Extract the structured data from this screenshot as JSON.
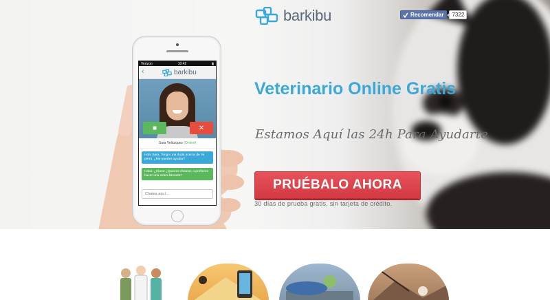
{
  "header": {
    "brand": "barkibu",
    "fb_like_label": "Recomendar",
    "fb_like_count": "7322"
  },
  "hero": {
    "headline": "Veterinario Online Gratis",
    "tagline": "Estamos Aquí las 24h Para Ayudarte",
    "cta_label": "PRUÉBALO AHORA",
    "cta_note": "30 días de prueba gratis, sin tarjeta de crédito."
  },
  "phone": {
    "carrier": "Verizon",
    "time": "10:42",
    "app_brand": "barkibu",
    "callee_name": "Sara Velázquez",
    "callee_status": "(Online)",
    "messages": [
      "Hola Sara, Tengo una duda acerca de mi perro. ¿Me puedes ayudar?",
      "Hola!. ¿Claro! ¿Quieres chatear, o prefieres hacer una video llamada?"
    ],
    "chat_placeholder": "Chatea aquí..."
  },
  "colors": {
    "brand_blue": "#3ba8d8",
    "cta_red": "#d9434b",
    "chat_green": "#5cb85c"
  },
  "icons": {
    "logo": "barkibu-logo-icon",
    "fb": "thumbs-up-icon",
    "back": "chevron-left-icon",
    "video_cam": "video-camera-icon",
    "end_call": "close-icon"
  }
}
